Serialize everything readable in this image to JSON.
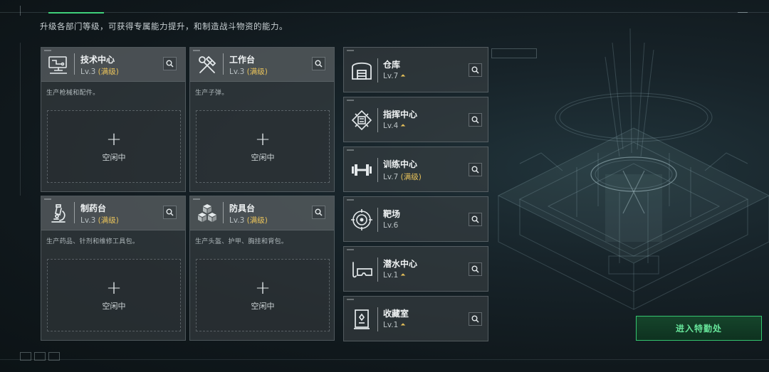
{
  "header": {
    "subtitle": "升级各部门等级，可获得专属能力提升，和制造战斗物资的能力。"
  },
  "modules": [
    {
      "name": "技术中心",
      "level": "Lv.3",
      "maxed": "(满级)",
      "desc": "生产枪械和配件。",
      "icon": "computer-workstation-icon",
      "slot": {
        "plus": "+",
        "status": "空闲中"
      }
    },
    {
      "name": "工作台",
      "level": "Lv.3",
      "maxed": "(满级)",
      "desc": "生产子弹。",
      "icon": "hammer-wrench-icon",
      "slot": {
        "plus": "+",
        "status": "空闲中"
      }
    },
    {
      "name": "制药台",
      "level": "Lv.3",
      "maxed": "(满级)",
      "desc": "生产药品、针剂和维修工具包。",
      "icon": "microscope-icon",
      "slot": {
        "plus": "+",
        "status": "空闲中"
      }
    },
    {
      "name": "防具台",
      "level": "Lv.3",
      "maxed": "(满级)",
      "desc": "生产头盔、护甲、胸挂和背包。",
      "icon": "armor-cubes-icon",
      "slot": {
        "plus": "+",
        "status": "空闲中"
      }
    }
  ],
  "facilities": [
    {
      "name": "仓库",
      "level": "Lv.7",
      "suffix": "",
      "upgradable": true,
      "icon": "warehouse-icon"
    },
    {
      "name": "指挥中心",
      "level": "Lv.4",
      "suffix": "",
      "upgradable": true,
      "icon": "chip-icon"
    },
    {
      "name": "训练中心",
      "level": "Lv.7",
      "suffix": "(满级)",
      "upgradable": false,
      "icon": "dumbbell-icon"
    },
    {
      "name": "靶场",
      "level": "Lv.6",
      "suffix": "",
      "upgradable": false,
      "icon": "target-icon"
    },
    {
      "name": "潜水中心",
      "level": "Lv.1",
      "suffix": "",
      "upgradable": true,
      "icon": "diving-mask-icon"
    },
    {
      "name": "收藏室",
      "level": "Lv.1",
      "suffix": "",
      "upgradable": true,
      "icon": "display-case-icon"
    }
  ],
  "actions": {
    "enter_label": "进入特勤处"
  },
  "colors": {
    "accent_green": "#34c56f",
    "maxed_gold": "#e8c25a",
    "background": "#10181c"
  }
}
